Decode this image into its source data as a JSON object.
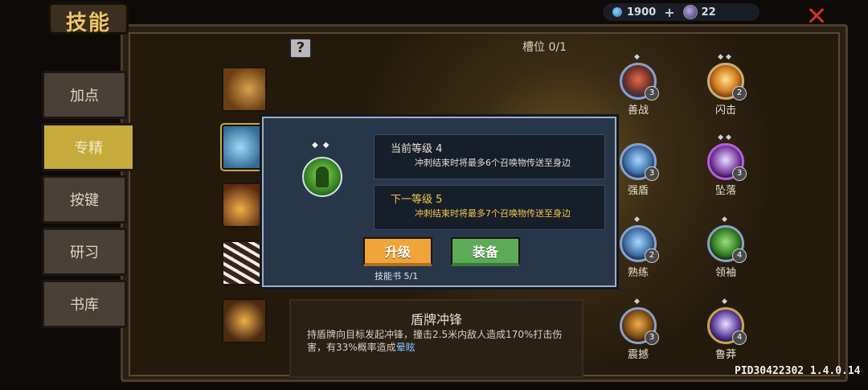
{
  "header": {
    "title": "技能",
    "gems": "1900",
    "coins": "22"
  },
  "tabs": [
    {
      "label": "加点",
      "active": false
    },
    {
      "label": "专精",
      "active": true
    },
    {
      "label": "按键",
      "active": false
    },
    {
      "label": "研习",
      "active": false
    },
    {
      "label": "书库",
      "active": false
    }
  ],
  "slot_label": "槽位 0/1",
  "description": {
    "title": "盾牌冲锋",
    "text_before": "持盾牌向目标发起冲锋，撞击2.5米内敌人造成170%打击伤害，有33%概率造成",
    "text_highlight": "晕眩"
  },
  "modal": {
    "current_level_label": "当前等级 4",
    "current_level_desc": "冲刺结束时将最多6个召唤物传送至身边",
    "next_level_label": "下一等级 5",
    "next_level_desc": "冲刺结束时将最多7个召唤物传送至身边",
    "upgrade_label": "升级",
    "equip_label": "装备",
    "book_count": "技能书 5/1"
  },
  "talents": [
    {
      "name": "善战",
      "level": "3",
      "pips": "◆",
      "color": "red"
    },
    {
      "name": "闪击",
      "level": "2",
      "pips": "◆◆",
      "color": "orange"
    },
    {
      "name": "强盾",
      "level": "3",
      "pips": "",
      "color": "blue"
    },
    {
      "name": "坠落",
      "level": "3",
      "pips": "◆◆",
      "color": "purple"
    },
    {
      "name": "熟练",
      "level": "2",
      "pips": "◆",
      "color": "blue"
    },
    {
      "name": "领袖",
      "level": "4",
      "pips": "◆",
      "color": "green"
    },
    {
      "name": "震撼",
      "level": "3",
      "pips": "◆",
      "color": "brown"
    },
    {
      "name": "鲁莽",
      "level": "4",
      "pips": "◆",
      "color": "violet"
    }
  ],
  "version": "PID30422302 1.4.0.14"
}
